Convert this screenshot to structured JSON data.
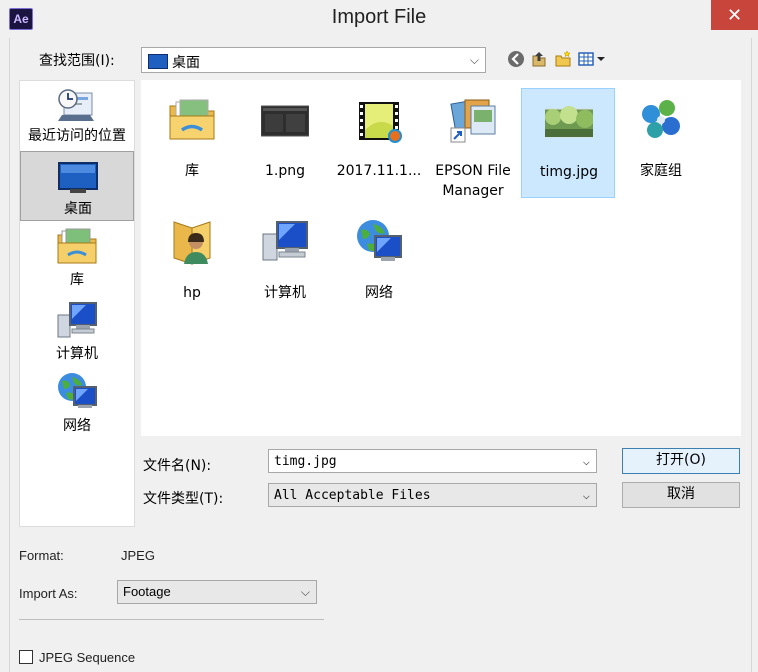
{
  "window": {
    "app_icon_text": "Ae",
    "title": "Import File",
    "close_glyph": "✕"
  },
  "lookin": {
    "label": "查找范围(I):",
    "value": "桌面",
    "arrow": "⌵"
  },
  "places": [
    {
      "label": "最近访问的位置",
      "icon": "recent-places-icon"
    },
    {
      "label": "桌面",
      "icon": "desktop-icon",
      "selected": true
    },
    {
      "label": "库",
      "icon": "libraries-icon"
    },
    {
      "label": "计算机",
      "icon": "computer-icon"
    },
    {
      "label": "网络",
      "icon": "network-icon"
    }
  ],
  "files": [
    {
      "name": "库",
      "icon": "libraries-folder-icon"
    },
    {
      "name": "1.png",
      "icon": "png-thumbnail-icon"
    },
    {
      "name": "2017.11.1...",
      "icon": "video-thumbnail-icon"
    },
    {
      "name": "EPSON File Manager",
      "icon": "epson-shortcut-icon"
    },
    {
      "name": "timg.jpg",
      "icon": "jpg-thumbnail-icon",
      "selected": true
    },
    {
      "name": "家庭组",
      "icon": "homegroup-icon"
    },
    {
      "name": "hp",
      "icon": "user-folder-icon"
    },
    {
      "name": "计算机",
      "icon": "computer-icon"
    },
    {
      "name": "网络",
      "icon": "network-icon"
    }
  ],
  "filename": {
    "label": "文件名(N):",
    "value": "timg.jpg",
    "arrow": "⌵"
  },
  "filetype": {
    "label": "文件类型(T):",
    "value": "All Acceptable Files",
    "arrow": "⌵"
  },
  "buttons": {
    "open": "打开(O)",
    "cancel": "取消"
  },
  "format": {
    "label": "Format:",
    "value": "JPEG"
  },
  "import_as": {
    "label": "Import As:",
    "value": "Footage",
    "arrow": "⌵"
  },
  "sequence": {
    "label": "JPEG Sequence",
    "checked": false
  }
}
